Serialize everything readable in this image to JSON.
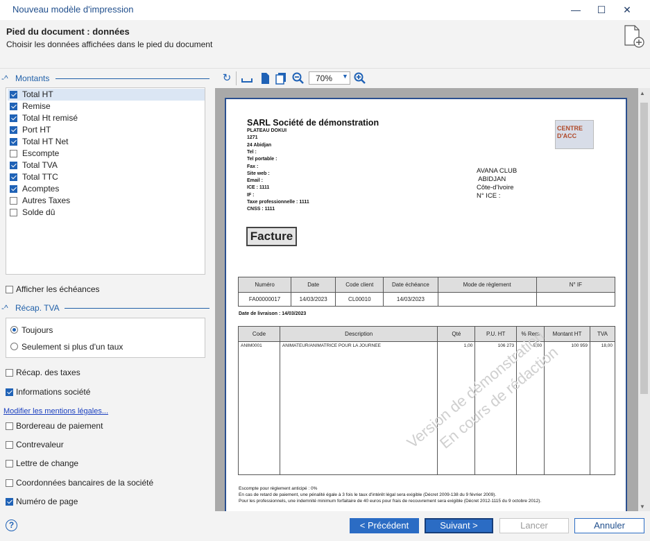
{
  "window": {
    "title": "Nouveau modèle d'impression",
    "min": "—",
    "max": "☐",
    "close": "✕"
  },
  "header": {
    "title": "Pied du document : données",
    "subtitle": "Choisir les données affichées dans le pied du document"
  },
  "montants": {
    "title": "Montants",
    "items": [
      {
        "label": "Total HT",
        "checked": true
      },
      {
        "label": "Remise",
        "checked": true
      },
      {
        "label": "Total Ht remisé",
        "checked": true
      },
      {
        "label": "Port HT",
        "checked": true
      },
      {
        "label": "Total HT Net",
        "checked": true
      },
      {
        "label": "Escompte",
        "checked": false
      },
      {
        "label": "Total TVA",
        "checked": true
      },
      {
        "label": "Total TTC",
        "checked": true
      },
      {
        "label": "Acomptes",
        "checked": true
      },
      {
        "label": "Autres Taxes",
        "checked": false
      },
      {
        "label": "Solde dû",
        "checked": false
      }
    ]
  },
  "afficher_echeances": {
    "label": "Afficher les échéances",
    "checked": false
  },
  "recap_tva": {
    "title": "Récap. TVA",
    "options": [
      {
        "label": "Toujours",
        "selected": true
      },
      {
        "label": "Seulement si plus d'un taux",
        "selected": false
      }
    ]
  },
  "options": {
    "recap_taxes": {
      "label": "Récap. des taxes",
      "checked": false
    },
    "infos_societe": {
      "label": "Informations société",
      "checked": true
    },
    "link_mentions": "Modifier les mentions légales...",
    "bordereau": {
      "label": "Bordereau de paiement",
      "checked": false
    },
    "contrevaleur": {
      "label": "Contrevaleur",
      "checked": false
    },
    "lettre_change": {
      "label": "Lettre de change",
      "checked": false
    },
    "coordonnees": {
      "label": "Coordonnées bancaires de la société",
      "checked": false
    },
    "numero_page": {
      "label": "Numéro de page",
      "checked": true
    }
  },
  "toolbar": {
    "zoom": "70%"
  },
  "doc": {
    "company": "SARL Société de démonstration",
    "address": [
      "PLATEAU DOKUI",
      "1271",
      "24 Abidjan",
      "Tel :",
      "Tel portable :",
      "Fax :",
      "Site web :",
      "Email :",
      "ICE : 1111",
      "IF :",
      "Taxe professionnelle : 1111",
      "CNSS : 1111"
    ],
    "logo_text": "CENTRE D'ACC",
    "client": [
      "AVANA CLUB",
      " ABIDJAN",
      "Côte-d'Ivoire",
      "N° ICE :"
    ],
    "doc_title": "Facture",
    "info_headers": [
      "Numéro",
      "Date",
      "Code client",
      "Date échéance",
      "Mode de règlement",
      "N° IF"
    ],
    "info_values": [
      "FA00000017",
      "14/03/2023",
      "CL00010",
      "14/03/2023",
      "",
      ""
    ],
    "delivery": "Date de livraison : 14/03/2023",
    "line_headers": [
      "Code",
      "Description",
      "Qté",
      "P.U. HT",
      "% Rem",
      "Montant HT",
      "TVA"
    ],
    "lines": [
      [
        "ANIM0001",
        "ANIMATEUR/ANIMATRICE POUR LA JOURNEE",
        "1,00",
        "106 273",
        "5,00",
        "100 959",
        "18,00"
      ]
    ],
    "watermark1": "Version de démonstration",
    "watermark2": "En cours de rédaction",
    "footer_notes": [
      "Escompte pour règlement anticipé : 0%",
      "En cas de retard de paiement, une pénalité égale à 3 fois le taux d'intérêt légal sera exigible (Décret 2009-138 du 9 février 2009).",
      "Pour les professionnels, une indemnité minimum forfaitaire de 40 euros pour frais de recouvrement sera exigible (Décret 2012-1115 du 9 octobre 2012)."
    ]
  },
  "footer": {
    "help": "?",
    "prev": "< Précédent",
    "next": "Suivant >",
    "cancel": "Lancer",
    "abort": "Annuler"
  }
}
